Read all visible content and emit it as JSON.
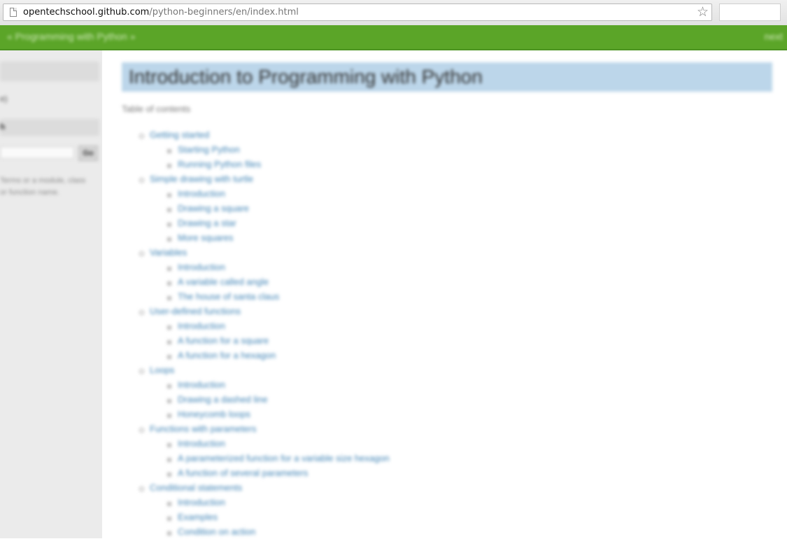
{
  "browser": {
    "url_host": "opentechschool.github.com",
    "url_path": "/python-beginners/en/index.html",
    "bookmark_icon": "star-icon",
    "page_icon": "page-icon"
  },
  "header": {
    "title": "« Programming with Python »",
    "right_link": "next"
  },
  "sidebar": {
    "heading1": "",
    "text1": "e)",
    "heading2": "h",
    "search_button": "Go",
    "search_placeholder": "",
    "hint": "Terms or a module, class or function name."
  },
  "main": {
    "title": "Introduction to Programming with Python",
    "toc_label": "Table of contents",
    "toc": [
      {
        "label": "Getting started",
        "children": [
          "Starting Python",
          "Running Python files"
        ]
      },
      {
        "label": "Simple drawing with turtle",
        "children": [
          "Introduction",
          "Drawing a square",
          "Drawing a star",
          "More squares"
        ]
      },
      {
        "label": "Variables",
        "children": [
          "Introduction",
          "A variable called angle",
          "The house of santa claus"
        ]
      },
      {
        "label": "User-defined functions",
        "children": [
          "Introduction",
          "A function for a square",
          "A function for a hexagon"
        ]
      },
      {
        "label": "Loops",
        "children": [
          "Introduction",
          "Drawing a dashed line",
          "Honeycomb loops"
        ]
      },
      {
        "label": "Functions with parameters",
        "children": [
          "Introduction",
          "A parameterized function for a variable size hexagon",
          "A function of several parameters"
        ]
      },
      {
        "label": "Conditional statements",
        "children": [
          "Introduction",
          "Examples",
          "Condition on action"
        ]
      }
    ]
  },
  "colors": {
    "header_green": "#5ba528",
    "title_band": "#bcd6ea",
    "link_blue": "#3f83b5",
    "sidebar_bg": "#ebebeb"
  }
}
